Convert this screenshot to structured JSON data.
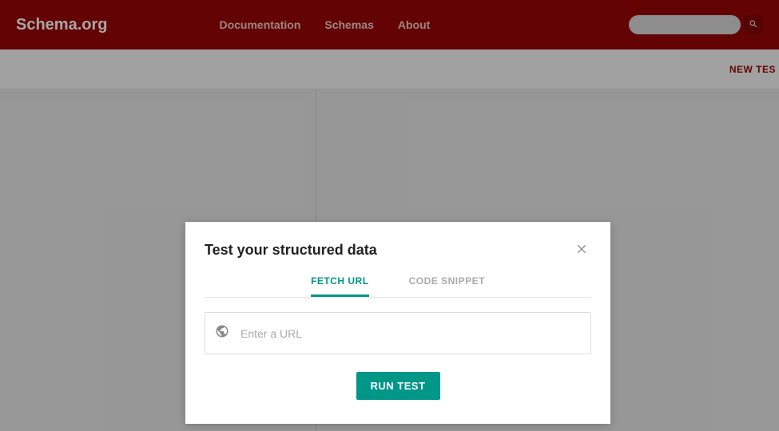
{
  "header": {
    "logo": "Schema.org",
    "nav": {
      "documentation": "Documentation",
      "schemas": "Schemas",
      "about": "About"
    },
    "search_placeholder": ""
  },
  "subbar": {
    "new_test": "NEW TES"
  },
  "modal": {
    "title": "Test your structured data",
    "tabs": {
      "fetch_url": "FETCH URL",
      "code_snippet": "CODE SNIPPET"
    },
    "url_placeholder": "Enter a URL",
    "run_label": "RUN TEST"
  }
}
